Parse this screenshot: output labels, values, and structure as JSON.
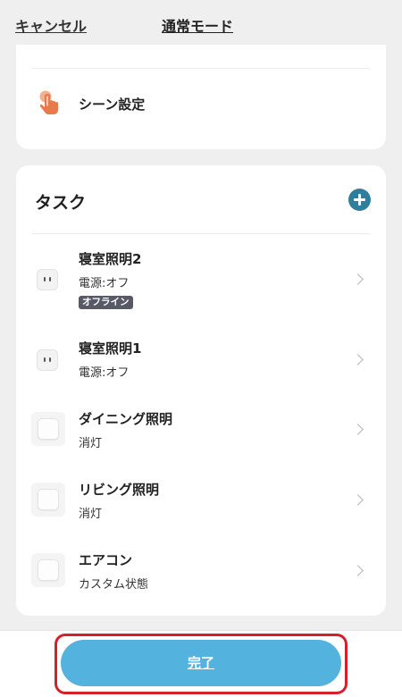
{
  "header": {
    "cancel_label": "キャンセル",
    "title": "通常モード"
  },
  "top_card": {
    "scene_label": "シーン設定",
    "scene_icon": "hand-pointer-icon"
  },
  "task_section": {
    "title": "タスク",
    "add_icon": "plus-circle-icon",
    "items": [
      {
        "name": "寝室照明2",
        "status": "電源:オフ",
        "badge": "オフライン",
        "icon": "plug-icon"
      },
      {
        "name": "寝室照明1",
        "status": "電源:オフ",
        "icon": "plug-icon"
      },
      {
        "name": "ダイニング照明",
        "status": "消灯",
        "icon": "wall-switch-icon"
      },
      {
        "name": "リビング照明",
        "status": "消灯",
        "icon": "wall-switch-icon"
      },
      {
        "name": "エアコン",
        "status": "カスタム状態",
        "icon": "wall-switch-icon"
      }
    ]
  },
  "footer": {
    "done_label": "完了"
  },
  "colors": {
    "accent": "#54b2df",
    "add_button": "#2f7f9a",
    "highlight": "#d3202a",
    "scene_icon": "#e8794a",
    "offline_badge": "#575a66"
  }
}
